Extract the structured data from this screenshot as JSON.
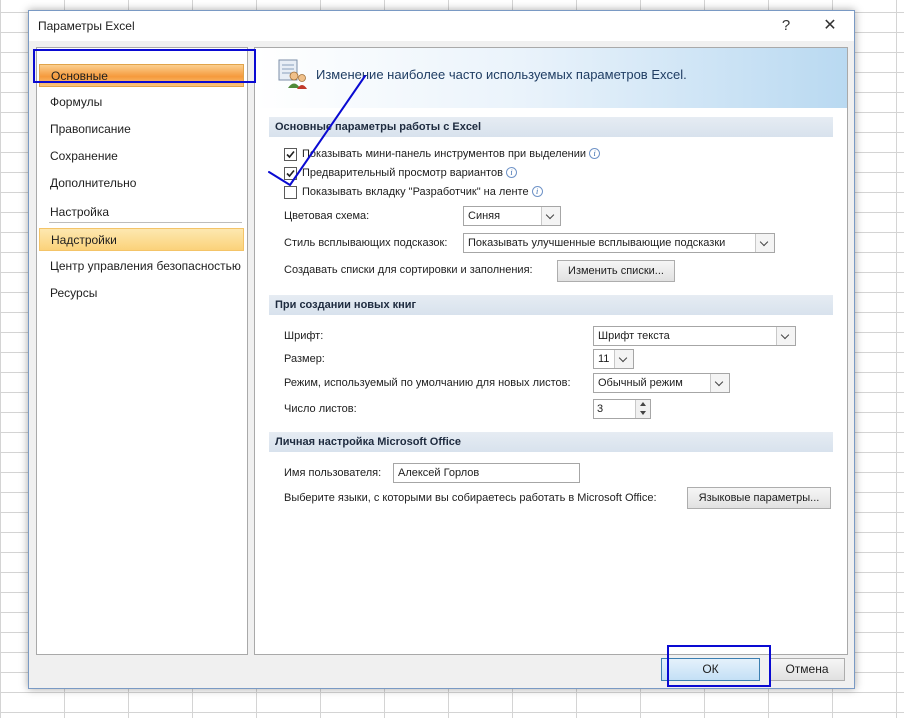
{
  "window": {
    "title": "Параметры Excel",
    "help_label": "?",
    "close_label": "✕"
  },
  "nav": {
    "items": [
      {
        "label": "Основные",
        "state": "selected"
      },
      {
        "label": "Формулы"
      },
      {
        "label": "Правописание"
      },
      {
        "label": "Сохранение"
      },
      {
        "label": "Дополнительно"
      },
      {
        "label": "Настройка"
      },
      {
        "label": "Надстройки",
        "state": "hover"
      },
      {
        "label": "Центр управления безопасностью"
      },
      {
        "label": "Ресурсы"
      }
    ]
  },
  "banner": {
    "text": "Изменение наиболее часто используемых параметров Excel.",
    "icon": "options-people-icon"
  },
  "section_main": {
    "header": "Основные параметры работы с Excel",
    "mini_toolbar": {
      "label": "Показывать мини-панель инструментов при выделении",
      "checked": true
    },
    "live_preview": {
      "label": "Предварительный просмотр вариантов",
      "checked": true
    },
    "developer_tab": {
      "label": "Показывать вкладку \"Разработчик\" на ленте",
      "checked": false
    },
    "color_scheme": {
      "label": "Цветовая схема:",
      "value": "Синяя"
    },
    "tooltip_style": {
      "label": "Стиль всплывающих подсказок:",
      "value": "Показывать улучшенные всплывающие подсказки"
    },
    "custom_lists": {
      "label": "Создавать списки для сортировки и заполнения:",
      "button": "Изменить списки..."
    }
  },
  "section_new": {
    "header": "При создании новых книг",
    "font": {
      "label": "Шрифт:",
      "value": "Шрифт текста"
    },
    "size": {
      "label": "Размер:",
      "value": "11"
    },
    "view": {
      "label": "Режим, используемый по умолчанию для новых листов:",
      "value": "Обычный режим"
    },
    "sheets": {
      "label": "Число листов:",
      "value": "3"
    }
  },
  "section_personal": {
    "header": "Личная настройка Microsoft Office",
    "username": {
      "label": "Имя пользователя:",
      "value": "Алексей Горлов"
    },
    "languages": {
      "label": "Выберите языки, с которыми вы собираетесь работать в Microsoft Office:",
      "button": "Языковые параметры..."
    }
  },
  "footer": {
    "ok": "ОК",
    "cancel": "Отмена"
  },
  "info_glyph": "i",
  "colors": {
    "annotation": "#0a0ad2",
    "selected_nav": "#f59a3c",
    "section_header": "#dbe4ee"
  }
}
